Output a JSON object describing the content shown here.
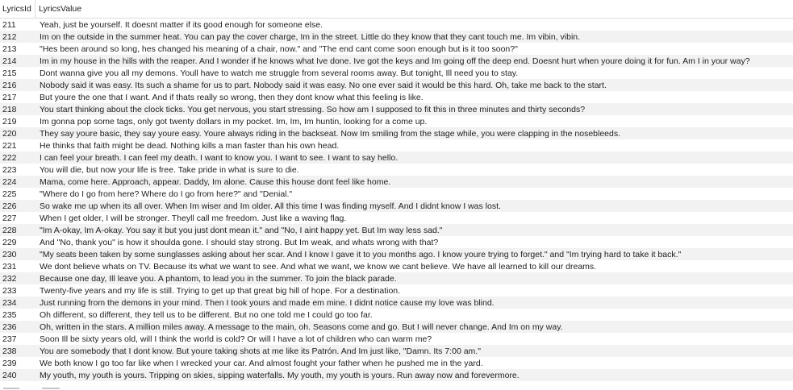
{
  "table": {
    "columns": [
      "LyricsId",
      "LyricsValue"
    ],
    "rows": [
      [
        "211",
        "Yeah, just be yourself. It doesnt matter if its good enough for someone else."
      ],
      [
        "212",
        "Im on the outside in the summer heat. You can pay the cover charge, Im in the street. Little do they know that they cant touch me. Im vibin, vibin."
      ],
      [
        "213",
        "\"Hes been around so long, hes changed his meaning of a chair, now.\" and \"The end cant come soon enough but is it too soon?\""
      ],
      [
        "214",
        "Im in my house in the hills with the reaper. And I wonder if he knows what Ive done. Ive got the keys and Im going off the deep end. Doesnt hurt when youre doing it for fun. Am I in your way?"
      ],
      [
        "215",
        "Dont wanna give you all my demons. Youll have to watch me struggle from several rooms away. But tonight, Ill need you to stay."
      ],
      [
        "216",
        "Nobody said it was easy. Its such a shame for us to part. Nobody said it was easy. No one ever said it would be this hard. Oh, take me back to the start."
      ],
      [
        "217",
        "But youre the one that I want. And if thats really so wrong, then they dont know what this feeling is like."
      ],
      [
        "218",
        "You start thinking about the clock ticks. You get nervous, you start stressing. So how am I supposed to fit this in three minutes and thirty seconds?"
      ],
      [
        "219",
        "Im gonna pop some tags, only got twenty dollars in my pocket. Im, Im, Im huntin, looking for a come up."
      ],
      [
        "220",
        "They say youre basic, they say youre easy. Youre always riding in the backseat. Now Im smiling from the stage while, you were clapping in the nosebleeds."
      ],
      [
        "221",
        "He thinks that faith might be dead. Nothing kills a man faster than his own head."
      ],
      [
        "222",
        "I can feel your breath. I can feel my death. I want to know you. I want to see. I want to say hello."
      ],
      [
        "223",
        "You will die, but now your life is free. Take pride in what is sure to die."
      ],
      [
        "224",
        "Mama, come here. Approach, appear. Daddy, Im alone. Cause this house dont feel like home."
      ],
      [
        "225",
        "\"Where do I go from here? Where do I go from here?\" and \"Denial.\""
      ],
      [
        "226",
        "So wake me up when its all over. When Im wiser and Im older. All this time I was finding myself. And I didnt know I was lost."
      ],
      [
        "227",
        "When I get older, I will be stronger. Theyll call me freedom. Just like a waving flag."
      ],
      [
        "228",
        "\"Im A-okay, Im A-okay. You say it but you just dont mean it.\" and \"No, I aint happy yet. But Im way less sad.\""
      ],
      [
        "229",
        "And \"No, thank you\" is how it shoulda gone. I should stay strong. But Im weak, and whats wrong with that?"
      ],
      [
        "230",
        "\"My seats been taken by some sunglasses asking about her scar. And I know I gave it to you months ago. I know youre trying to forget.\" and \"Im trying hard to take it back.\""
      ],
      [
        "231",
        "We dont believe whats on TV. Because its what we want to see. And what we want, we know we cant believe. We have all learned to kill our dreams."
      ],
      [
        "232",
        "Because one day, Ill leave you. A phantom, to lead you in the summer. To join the black parade."
      ],
      [
        "233",
        "Twenty-five years and my life is still. Trying to get up that great big hill of hope. For a destination."
      ],
      [
        "234",
        "Just running from the demons in your mind. Then I took yours and made em mine. I didnt notice cause my love was blind."
      ],
      [
        "235",
        "Oh different, so different, they tell us to be different. But no one told me I could go too far."
      ],
      [
        "236",
        "Oh, written in the stars. A million miles away. A message to the main, oh. Seasons come and go. But I will never change. And Im on my way."
      ],
      [
        "237",
        "Soon Ill be sixty years old, will I think the world is cold? Or will I have a lot of children who can warm me?"
      ],
      [
        "238",
        "You are somebody that I dont know. But youre taking shots at me like its Patrón. And Im just like, \"Damn. Its 7:00 am.\""
      ],
      [
        "239",
        "We both know I go too far like when I wrecked your car. And almost fought your father when he pushed me in the yard."
      ],
      [
        "240",
        "My youth, my youth is yours. Tripping on skies, sipping waterfalls. My youth, my youth is yours. Run away now and forevermore."
      ]
    ]
  }
}
